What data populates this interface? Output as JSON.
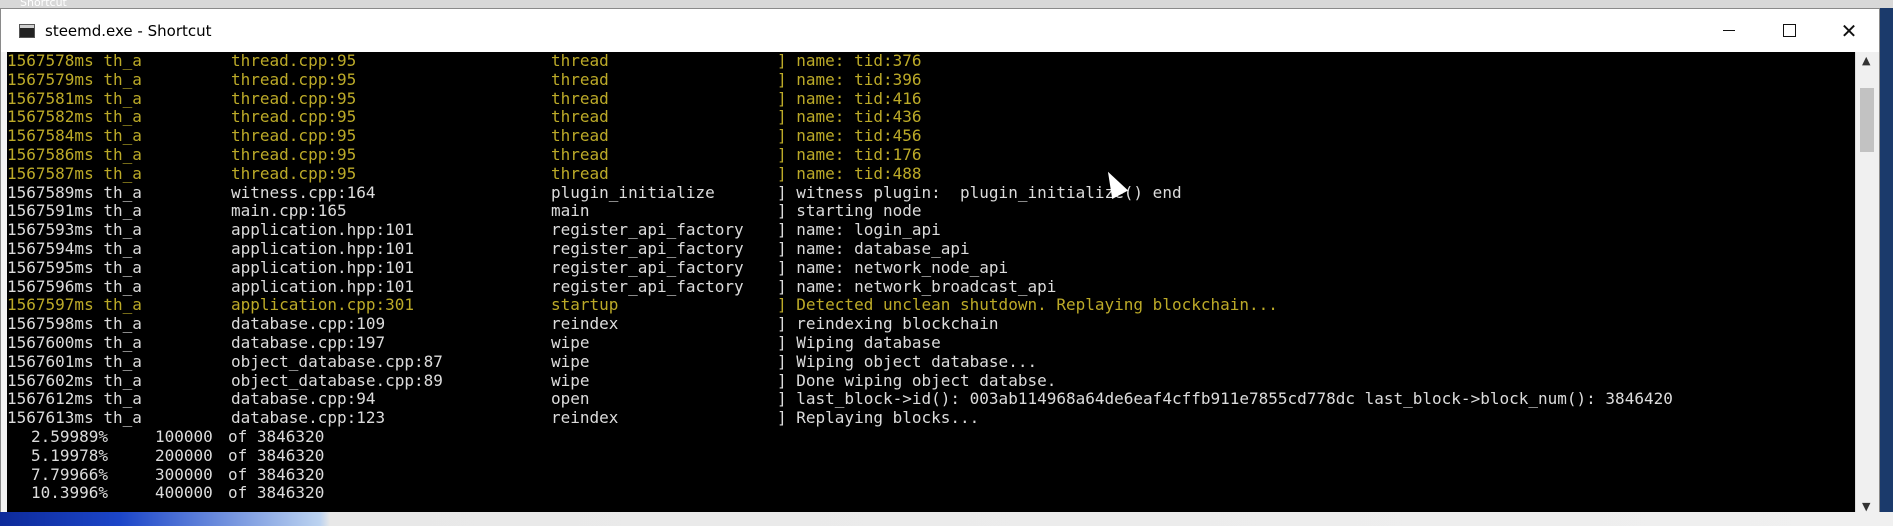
{
  "desktop": {
    "strip_label": "Shortcut"
  },
  "window": {
    "title": "steemd.exe - Shortcut",
    "controls": {
      "minimize": "—",
      "maximize": "□",
      "close": "✕"
    }
  },
  "console": {
    "lines": [
      {
        "color": "yellow",
        "time": "1567578ms th_a",
        "file": "thread.cpp:95",
        "method": "thread",
        "msg": "] name: tid:376"
      },
      {
        "color": "yellow",
        "time": "1567579ms th_a",
        "file": "thread.cpp:95",
        "method": "thread",
        "msg": "] name: tid:396"
      },
      {
        "color": "yellow",
        "time": "1567581ms th_a",
        "file": "thread.cpp:95",
        "method": "thread",
        "msg": "] name: tid:416"
      },
      {
        "color": "yellow",
        "time": "1567582ms th_a",
        "file": "thread.cpp:95",
        "method": "thread",
        "msg": "] name: tid:436"
      },
      {
        "color": "yellow",
        "time": "1567584ms th_a",
        "file": "thread.cpp:95",
        "method": "thread",
        "msg": "] name: tid:456"
      },
      {
        "color": "yellow",
        "time": "1567586ms th_a",
        "file": "thread.cpp:95",
        "method": "thread",
        "msg": "] name: tid:176"
      },
      {
        "color": "yellow",
        "time": "1567587ms th_a",
        "file": "thread.cpp:95",
        "method": "thread",
        "msg": "] name: tid:488"
      },
      {
        "color": "white",
        "time": "1567589ms th_a",
        "file": "witness.cpp:164",
        "method": "plugin_initialize",
        "msg": "] witness plugin:  plugin_initialize() end"
      },
      {
        "color": "white",
        "time": "1567591ms th_a",
        "file": "main.cpp:165",
        "method": "main",
        "msg": "] starting node"
      },
      {
        "color": "white",
        "time": "1567593ms th_a",
        "file": "application.hpp:101",
        "method": "register_api_factory",
        "msg": "] name: login_api"
      },
      {
        "color": "white",
        "time": "1567594ms th_a",
        "file": "application.hpp:101",
        "method": "register_api_factory",
        "msg": "] name: database_api"
      },
      {
        "color": "white",
        "time": "1567595ms th_a",
        "file": "application.hpp:101",
        "method": "register_api_factory",
        "msg": "] name: network_node_api"
      },
      {
        "color": "white",
        "time": "1567596ms th_a",
        "file": "application.hpp:101",
        "method": "register_api_factory",
        "msg": "] name: network_broadcast_api"
      },
      {
        "color": "yellow",
        "time": "1567597ms th_a",
        "file": "application.cpp:301",
        "method": "startup",
        "msg": "] Detected unclean shutdown. Replaying blockchain..."
      },
      {
        "color": "white",
        "time": "1567598ms th_a",
        "file": "database.cpp:109",
        "method": "reindex",
        "msg": "] reindexing blockchain"
      },
      {
        "color": "white",
        "time": "1567600ms th_a",
        "file": "database.cpp:197",
        "method": "wipe",
        "msg": "] Wiping database"
      },
      {
        "color": "white",
        "time": "1567601ms th_a",
        "file": "object_database.cpp:87",
        "method": "wipe",
        "msg": "] Wiping object database..."
      },
      {
        "color": "white",
        "time": "1567602ms th_a",
        "file": "object_database.cpp:89",
        "method": "wipe",
        "msg": "] Done wiping object databse."
      },
      {
        "color": "white",
        "time": "1567612ms th_a",
        "file": "database.cpp:94",
        "method": "open",
        "msg": "] last_block->id(): 003ab114968a64de6eaf4cffb911e7855cd778dc last_block->block_num(): 3846420"
      },
      {
        "color": "white",
        "time": "1567613ms th_a",
        "file": "database.cpp:123",
        "method": "reindex",
        "msg": "] Replaying blocks..."
      }
    ],
    "progress": [
      {
        "pct": "2.59989%",
        "count": "100000",
        "total": "of 3846320"
      },
      {
        "pct": "5.19978%",
        "count": "200000",
        "total": "of 3846320"
      },
      {
        "pct": "7.79966%",
        "count": "300000",
        "total": "of 3846320"
      },
      {
        "pct": "10.3996%",
        "count": "400000",
        "total": "of 3846320"
      }
    ]
  },
  "colors": {
    "log_yellow": "#bcaa28",
    "log_white": "#dcdcdc",
    "console_bg": "#000000"
  },
  "icons": {
    "app": "console-app-icon",
    "cursor": "mouse-pointer-icon"
  }
}
